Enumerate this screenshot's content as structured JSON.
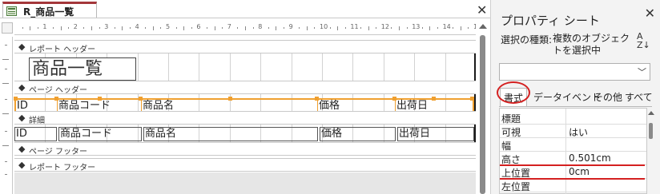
{
  "document_tab": {
    "title": "R_商品一覧",
    "icon": "report-icon"
  },
  "ruler": {
    "numbers": [
      "1",
      "2",
      "3",
      "4",
      "5",
      "6",
      "7",
      "8",
      "9",
      "10",
      "11",
      "12",
      "13",
      "14",
      "15"
    ]
  },
  "sections": {
    "report_header": "レポート ヘッダー",
    "page_header": "ページ ヘッダー",
    "detail": "詳細",
    "page_footer": "ページ フッター",
    "report_footer": "レポート フッター"
  },
  "report_title": "商品一覧",
  "page_header_labels": [
    "ID",
    "商品コード",
    "商品名",
    "価格",
    "出荷日"
  ],
  "detail_fields": [
    "ID",
    "商品コード",
    "商品名",
    "価格",
    "出荷日"
  ],
  "property_sheet": {
    "title": "プロパティ シート",
    "selection_label": "選択の種類:",
    "selection_value": "複数のオブジェクトを選択中",
    "combo_value": "",
    "tabs": [
      "書式",
      "データ",
      "イベント",
      "その他",
      "すべて"
    ],
    "active_tab": "書式",
    "rows": [
      {
        "name": "標題",
        "value": ""
      },
      {
        "name": "可視",
        "value": "はい"
      },
      {
        "name": "幅",
        "value": ""
      },
      {
        "name": "高さ",
        "value": "0.501cm"
      },
      {
        "name": "上位置",
        "value": "0cm"
      },
      {
        "name": "左位置",
        "value": ""
      }
    ]
  },
  "colors": {
    "selection_orange": "#f0a030",
    "annotation_red": "#d42020",
    "tab_accent": "#a4373a"
  }
}
